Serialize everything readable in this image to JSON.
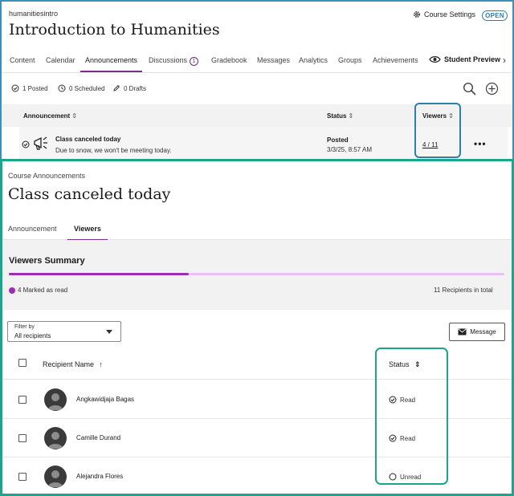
{
  "course": {
    "code": "humanitiesintro",
    "title": "Introduction to Humanities",
    "settings_label": "Course Settings",
    "status_badge": "OPEN"
  },
  "nav": {
    "tabs": [
      {
        "label": "Content"
      },
      {
        "label": "Calendar"
      },
      {
        "label": "Announcements"
      },
      {
        "label": "Discussions",
        "badge": "1"
      },
      {
        "label": "Gradebook"
      },
      {
        "label": "Messages"
      },
      {
        "label": "Analytics"
      },
      {
        "label": "Groups"
      },
      {
        "label": "Achievements"
      }
    ],
    "active_tab": "Announcements",
    "student_preview": "Student Preview",
    "more_arrow": "›"
  },
  "summary": {
    "posted": "1 Posted",
    "scheduled": "0 Scheduled",
    "drafts": "0 Drafts"
  },
  "announcements_table": {
    "headers": {
      "announcement": "Announcement",
      "status": "Status",
      "viewers": "Viewers",
      "sort_symbol": "⇕"
    },
    "row": {
      "title": "Class canceled today",
      "description": "Due to snow, we won't be meeting today.",
      "status": "Posted",
      "date": "3/3/25, 8:57 AM",
      "viewers": "4 / 11",
      "menu": "•••"
    }
  },
  "detail": {
    "breadcrumb": "Course Announcements",
    "title": "Class canceled today",
    "tabs": [
      {
        "label": "Announcement"
      },
      {
        "label": "Viewers"
      }
    ],
    "active_tab": "Viewers",
    "viewers_summary": {
      "title": "Viewers Summary",
      "marked_label": "4 Marked as read",
      "total_label": "11 Recipients in total",
      "read_count": 4,
      "total_count": 11,
      "read_color": "#9c2eb4"
    },
    "filter": {
      "label": "Filter by",
      "value": "All recipients"
    },
    "message_button": "Message",
    "recipients_table": {
      "headers": {
        "name": "Recipient Name",
        "name_sort": "↑",
        "status": "Status",
        "status_sort": "⇕"
      },
      "rows": [
        {
          "name": "Angkawidjaja Bagas",
          "status": "Read",
          "read": true
        },
        {
          "name": "Camille Durand",
          "status": "Read",
          "read": true
        },
        {
          "name": "Alejandra Flores",
          "status": "Unread",
          "read": false
        }
      ]
    }
  },
  "colors": {
    "accent_purple": "#7a2e8e",
    "top_highlight": "#2e7fa8",
    "bottom_highlight": "#1aa58c"
  }
}
